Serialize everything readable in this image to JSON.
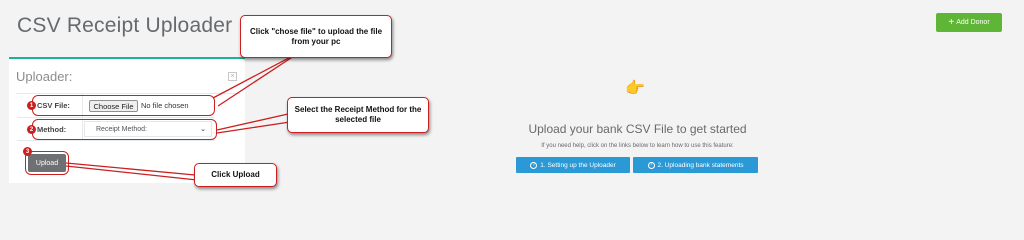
{
  "header": {
    "title": "CSV Receipt Uploader",
    "add_donor_label": "Add Donor",
    "add_donor_icon": "+"
  },
  "panel": {
    "title": "Uploader:",
    "close_icon": "×",
    "csv_label": "CSV File:",
    "choose_file_label": "Choose File",
    "no_file_text": "No file chosen",
    "method_label": "Method:",
    "method_selected": "Receipt Method:",
    "upload_label": "Upload"
  },
  "annotations": {
    "badges": [
      "1",
      "2",
      "3"
    ],
    "callout_choose": "Click \"chose file\" to upload the file from your pc",
    "callout_method": "Select the Receipt Method for the selected file",
    "callout_upload": "Click Upload",
    "color": "#cc1f1f"
  },
  "right": {
    "pointer_icon": "👉",
    "heading": "Upload your bank CSV File to get started",
    "help_text": "If you need help, click on the links below to learn how to use this feature:",
    "help_buttons": [
      {
        "label": "1. Setting up the Uploader",
        "icon": "?"
      },
      {
        "label": "2. Uploading bank statements",
        "icon": "?"
      }
    ]
  },
  "colors": {
    "accent": "#1ab394",
    "add_donor": "#5fb536",
    "help_button": "#2b99d6",
    "upload_button": "#6e7074"
  }
}
